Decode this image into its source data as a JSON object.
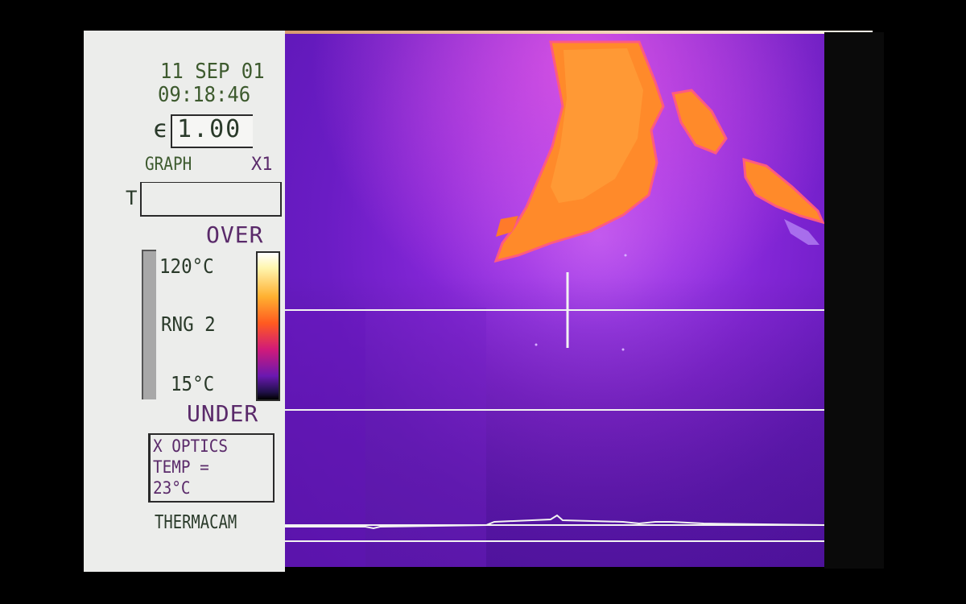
{
  "overlay": {
    "date": "11 SEP 01",
    "time": "09:18:46",
    "emissivity_symbol": "ϵ",
    "emissivity_value": "1.00",
    "graph_label": "GRAPH",
    "zoom": "X1",
    "t_label": "T",
    "over_label": "OVER",
    "temp_max": "120°C",
    "range_label": "RNG 2",
    "temp_min": "15°C",
    "under_label": "UNDER",
    "optics_line1": "X OPTICS",
    "optics_line2": "TEMP =",
    "optics_line3": "23°C",
    "brand": "THERMACAM"
  },
  "colors": {
    "panel_bg": "#ecedeb",
    "hot_region": "#ff8a2a",
    "background_cold": "#7a24d0",
    "crosshair": "#f2f2f2"
  },
  "icons": {
    "crosshair": "crosshair-icon",
    "temperature_scale": "color-scale-bar"
  }
}
